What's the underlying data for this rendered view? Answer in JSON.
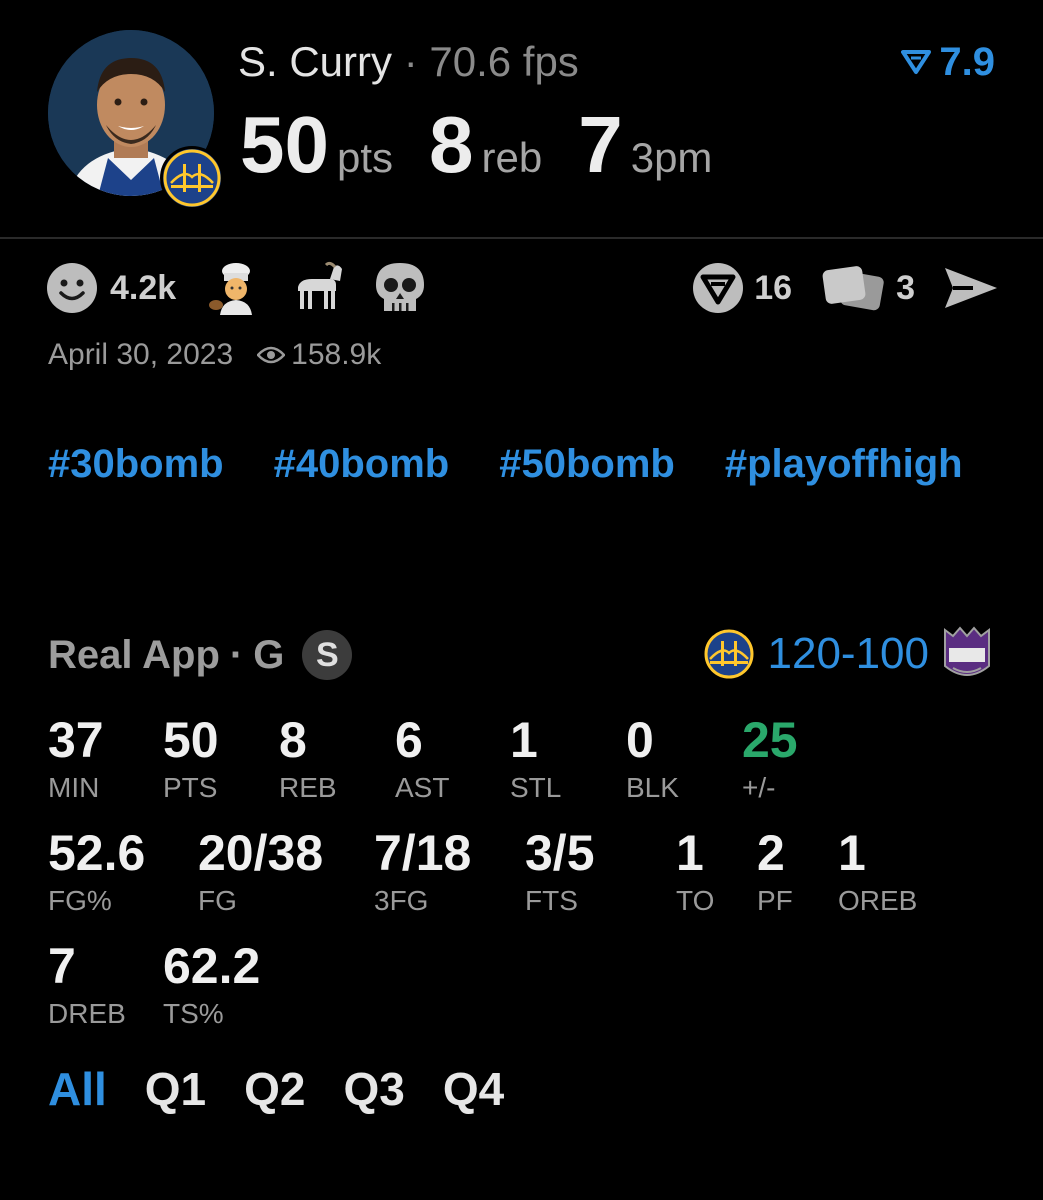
{
  "player": {
    "name": "S. Curry",
    "separator": "·",
    "fps": "70.6 fps",
    "rating": "7.9",
    "avatar_icon": "player-headshot",
    "team_icon": "warriors-logo"
  },
  "headline": [
    {
      "value": "50",
      "unit": "pts"
    },
    {
      "value": "8",
      "unit": "reb"
    },
    {
      "value": "7",
      "unit": "3pm"
    }
  ],
  "reactions": {
    "smile_count": "4.2k",
    "icons": [
      "smile-face-icon",
      "chef-emoji-icon",
      "goat-emoji-icon",
      "skull-emoji-icon"
    ]
  },
  "actions": {
    "vote_count": "16",
    "cards_count": "3",
    "icons": [
      "vote-icon",
      "cards-icon",
      "share-send-icon"
    ]
  },
  "meta": {
    "date": "April 30, 2023",
    "views": "158.9k"
  },
  "hashtags": [
    "#30bomb",
    "#40bomb",
    "#50bomb",
    "#playoffhigh"
  ],
  "game": {
    "source": "Real App",
    "separator": "·",
    "position": "G",
    "badge": "S",
    "score_home": "120",
    "score_dash": "-",
    "score_away": "100"
  },
  "stats": [
    {
      "value": "37",
      "label": "MIN"
    },
    {
      "value": "50",
      "label": "PTS"
    },
    {
      "value": "8",
      "label": "REB"
    },
    {
      "value": "6",
      "label": "AST"
    },
    {
      "value": "1",
      "label": "STL"
    },
    {
      "value": "0",
      "label": "BLK"
    },
    {
      "value": "25",
      "label": "+/-"
    },
    {
      "value": "52.6",
      "label": "FG%"
    },
    {
      "value": "20/38",
      "label": "FG"
    },
    {
      "value": "7/18",
      "label": "3FG"
    },
    {
      "value": "3/5",
      "label": "FTS"
    },
    {
      "value": "1",
      "label": "TO"
    },
    {
      "value": "2",
      "label": "PF"
    },
    {
      "value": "1",
      "label": "OREB"
    },
    {
      "value": "7",
      "label": "DREB"
    },
    {
      "value": "62.2",
      "label": "TS%"
    }
  ],
  "tabs": [
    "All",
    "Q1",
    "Q2",
    "Q3",
    "Q4"
  ],
  "active_tab": "All",
  "colors": {
    "accent": "#2f8fe0",
    "positive": "#2aa86b",
    "background": "#000000"
  }
}
